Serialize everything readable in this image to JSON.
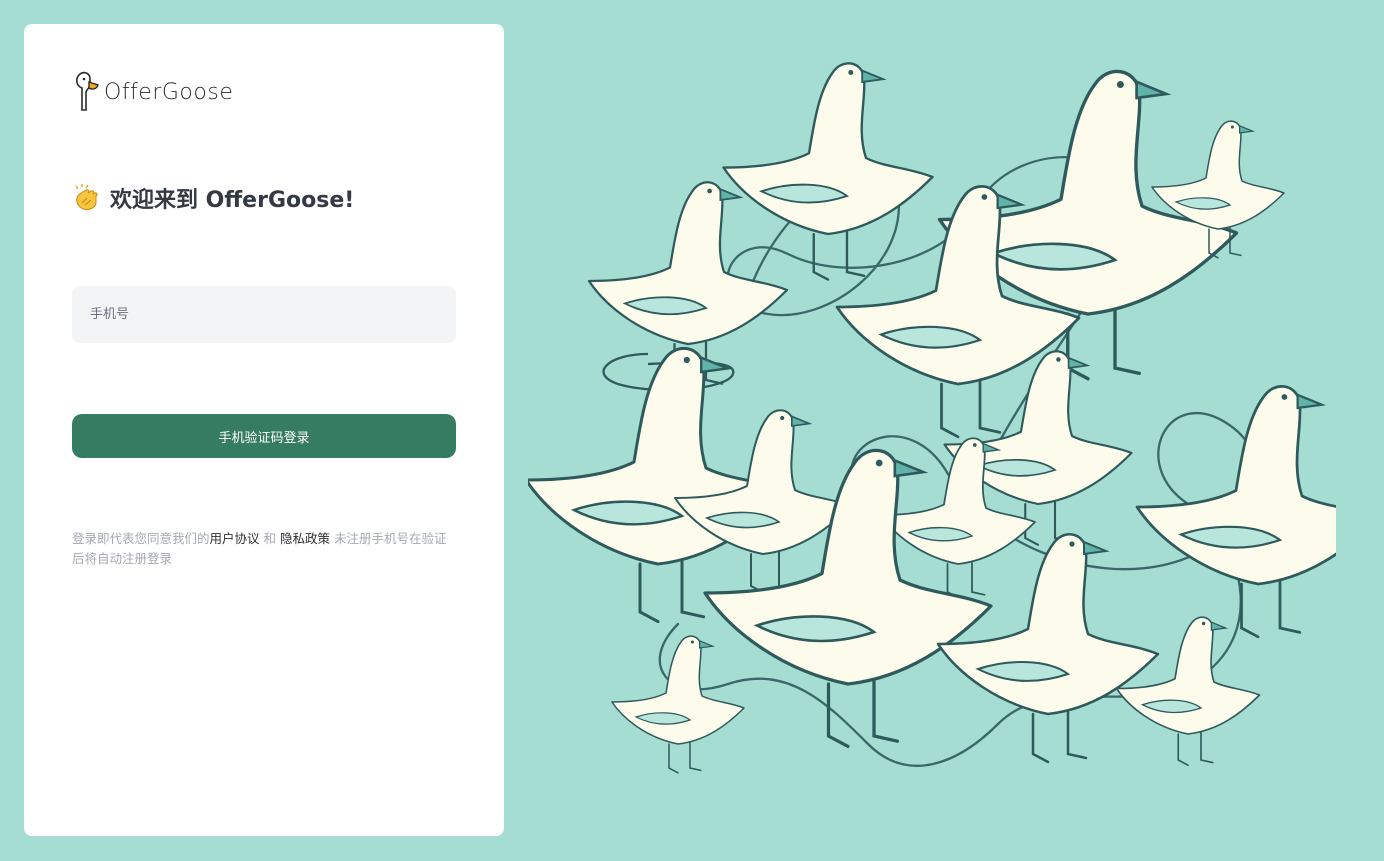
{
  "brand": {
    "name": "OfferGoose"
  },
  "welcome": {
    "title": "欢迎来到 OfferGoose!"
  },
  "phone": {
    "placeholder": "手机号",
    "value": ""
  },
  "login": {
    "button_label": "手机验证码登录"
  },
  "terms": {
    "prefix": "登录即代表您同意我们的",
    "user_agreement": "用户协议",
    "and": " 和 ",
    "privacy_policy": "隐私政策",
    "suffix": " 未注册手机号在验证后将自动注册登录"
  },
  "colors": {
    "background": "#a5ddd3",
    "primary_button": "#367c60",
    "card": "#ffffff",
    "goose_body": "#fdfbec",
    "goose_line": "#2f5a5c",
    "beak": "#5fb3a8"
  },
  "icons": {
    "logo": "goose-logo-icon",
    "welcome": "clapping-hands-icon"
  }
}
